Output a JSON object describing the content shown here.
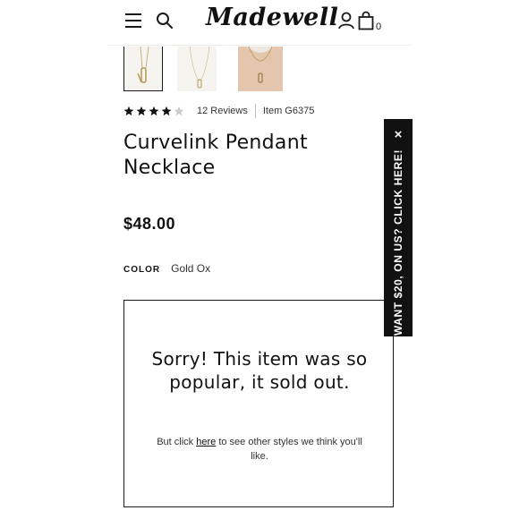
{
  "header": {
    "logo_text": "Madewell",
    "bag_count": "0",
    "icons": [
      "menu-icon",
      "search-icon",
      "account-icon",
      "bag-icon"
    ]
  },
  "gallery": {
    "thumbnails": [
      "thumbnail-1",
      "thumbnail-2",
      "thumbnail-3"
    ],
    "selected_index": 0
  },
  "product": {
    "rating": 4,
    "rating_max": 5,
    "reviews_label": "12 Reviews",
    "item_number": "Item G6375",
    "title": "Curvelink Pendant Necklace",
    "price": "$48.00",
    "color_label": "COLOR",
    "color_value": "Gold Ox"
  },
  "sold_out": {
    "heading": "Sorry! This item was so popular, it sold out.",
    "text_before": "But click ",
    "link_text": "here",
    "text_after": " to see other styles we think you'll like."
  },
  "promo": {
    "label": "WANT $20, ON US? CLICK HERE!",
    "close_symbol": "×"
  },
  "colors": {
    "accent": "#111111",
    "star_filled": "#111111",
    "star_empty": "#cccccc"
  }
}
